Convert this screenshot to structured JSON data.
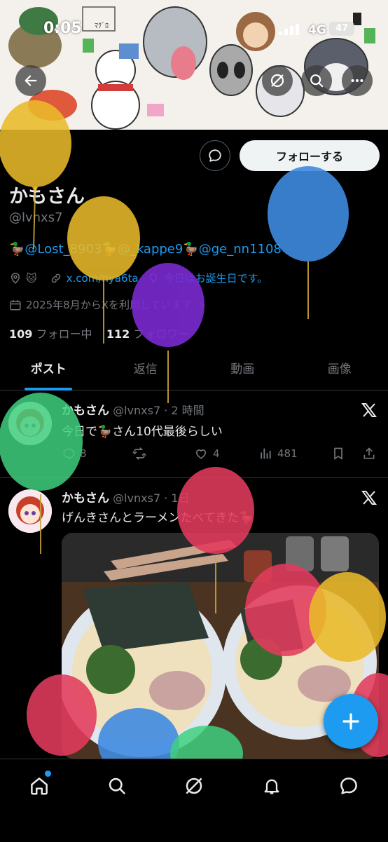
{
  "status_bar": {
    "time": "0:05",
    "network": "4G",
    "battery": "47"
  },
  "profile": {
    "follow_label": "フォローする",
    "name": "かもさん",
    "handle": "@lvnxs7",
    "bio_mentions": [
      "@Lost_8903",
      "@_kappe9",
      "@ge_nn1108"
    ],
    "location_emoji": "🐱",
    "website": "x.com/nya6ta",
    "birthday": "今日はお誕生日です。",
    "joined": "2025年8月からXを利用しています",
    "following_count": "109",
    "following_label": "フォロー中",
    "followers_count": "112",
    "followers_label": "フォロワー"
  },
  "tabs": [
    "ポスト",
    "返信",
    "動画",
    "画像"
  ],
  "posts": [
    {
      "name": "かもさん",
      "meta": "@lvnxs7 · 2 時間",
      "text": "今日で🦆さん10代最後らしい",
      "replies": "8",
      "likes": "4",
      "views": "481"
    },
    {
      "name": "かもさん",
      "meta": "@lvnxs7 · 1日",
      "text": "げんきさんとラーメンたべてきた🦆"
    }
  ],
  "colors": {
    "accent": "#1d9bf0",
    "background": "#000000",
    "secondary_text": "#71767b"
  }
}
